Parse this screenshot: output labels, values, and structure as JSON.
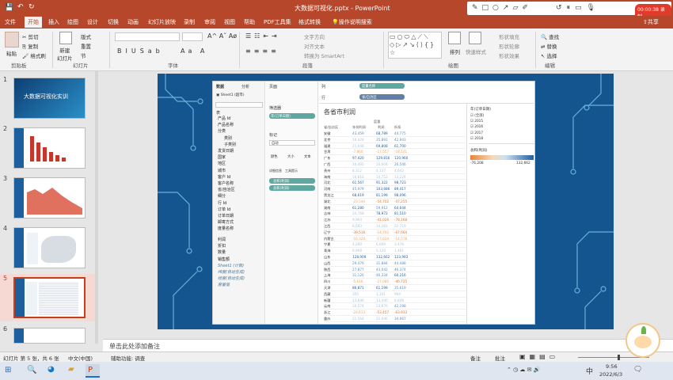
{
  "window": {
    "title": "大数据可视化.pptx - PowerPoint"
  },
  "ribbon_tabs": [
    "文件",
    "开始",
    "插入",
    "绘图",
    "设计",
    "切换",
    "动画",
    "幻灯片放映",
    "录制",
    "审阅",
    "视图",
    "帮助",
    "PDF工具集",
    "格式转换",
    "操作说明搜索"
  ],
  "share_label": "共享",
  "recording": {
    "time": "00:00:38 录制"
  },
  "ribbon": {
    "paste": "粘贴",
    "cut": "剪切",
    "copy": "复制",
    "format_painter": "格式刷",
    "new_slide": "新建\n幻灯片",
    "layout": "版式",
    "reset": "重置",
    "section": "节",
    "text_direction": "文字方向",
    "align_text": "对齐文本",
    "smartart": "转换为 SmartArt",
    "arrange": "排列",
    "quick_styles": "快速样式",
    "shape_fill": "形状填充",
    "shape_outline": "形状轮廓",
    "shape_effects": "形状效果",
    "find": "查找",
    "replace": "替换",
    "select": "选择",
    "groups": {
      "clipboard": "剪贴板",
      "slides": "幻灯片",
      "font": "字体",
      "paragraph": "段落",
      "drawing": "绘图",
      "editing": "编辑"
    }
  },
  "thumbnails": [
    {
      "num": "1",
      "title": "大数据可视化实训"
    },
    {
      "num": "2"
    },
    {
      "num": "3"
    },
    {
      "num": "4"
    },
    {
      "num": "5"
    },
    {
      "num": "6"
    }
  ],
  "tableau": {
    "tab_data": "数据",
    "tab_analysis": "分析",
    "source": "Sheet1 (超市)",
    "table_label": "表",
    "fields": [
      "产品 Id",
      "产品名称",
      "分类",
      "类别",
      "子类别",
      "发货日期",
      "国家",
      "地区",
      "城市",
      "客户 Id",
      "客户名称",
      "省/自治区",
      "细分",
      "行 Id",
      "订单 Id",
      "订单日期",
      "邮寄方式",
      "度量名称"
    ],
    "measures": [
      "利润",
      "折扣",
      "数量",
      "销售额",
      "Sheet1 (计数)",
      "纬度(自动生成)",
      "经度(自动生成)",
      "度量值"
    ],
    "pages": "页面",
    "filters": "筛选器",
    "filter_pill": "年(订单日期)",
    "marks": "标记",
    "mark_type": "自动",
    "mark_buttons": [
      "颜色",
      "大小",
      "文本",
      "详细信息",
      "工具提示"
    ],
    "mark_pills": [
      "总和(利润)",
      "总和(利润)"
    ],
    "columns": "列",
    "rows": "行",
    "col_pill": "度量名称",
    "row_pill": "省/自治区",
    "chart_title": "各省市利润",
    "col_header_group": "度量",
    "col_headers": [
      "省/自治区",
      "年份利润",
      "利润",
      "折扣"
    ],
    "rows_data": [
      [
        "安徽",
        "43,459",
        "68,789",
        "44,775"
      ],
      [
        "北京",
        "19,428",
        "35,891",
        "42,943"
      ],
      [
        "福建",
        "21,048",
        "69,808",
        "61,700"
      ],
      [
        "甘肃",
        "-7,860",
        "-17,557",
        "-18,141"
      ],
      [
        "广东",
        "97,420",
        "129,816",
        "120,960"
      ],
      [
        "广西",
        "16,491",
        "24,004",
        "26,546"
      ],
      [
        "贵州",
        "8,312",
        "4,137",
        "4,642"
      ],
      [
        "海南",
        "16,616",
        "14,752",
        "13,224"
      ],
      [
        "河北",
        "61,567",
        "91,322",
        "98,723"
      ],
      [
        "河南",
        "45,979",
        "103,686",
        "89,417"
      ],
      [
        "黑龙江",
        "68,619",
        "81,199",
        "98,096"
      ],
      [
        "湖北",
        "-23,540",
        "-54,702",
        "-47,255"
      ],
      [
        "湖南",
        "61,280",
        "59,912",
        "64,644"
      ],
      [
        "吉林",
        "24,768",
        "78,972",
        "81,510"
      ],
      [
        "江苏",
        "9,964",
        "-41,026",
        "-78,168"
      ],
      [
        "江西",
        "6,693",
        "14,281",
        "22,719"
      ],
      [
        "辽宁",
        "-39,516",
        "-14,792",
        "-67,664"
      ],
      [
        "内蒙古",
        "-10,324",
        "-17,624",
        "-14,578"
      ],
      [
        "宁夏",
        "4,290",
        "6,609",
        "3,476"
      ],
      [
        "青海",
        "6,908",
        "5,120",
        "1,461"
      ],
      [
        "山东",
        "128,909",
        "132,662",
        "123,993"
      ],
      [
        "山西",
        "29,476",
        "31,884",
        "44,488"
      ],
      [
        "陕西",
        "27,877",
        "43,042",
        "46,374"
      ],
      [
        "上海",
        "31,126",
        "46,334",
        "60,216"
      ],
      [
        "四川",
        "-5,616",
        "-27,085",
        "-46,725"
      ],
      [
        "天津",
        "86,871",
        "61,199",
        "35,619"
      ],
      [
        "西藏",
        "350",
        "1,101",
        "994"
      ],
      [
        "新疆",
        "13,846",
        "13,440",
        "8,848"
      ],
      [
        "云南",
        "20,574",
        "23,670",
        "42,198"
      ],
      [
        "浙江",
        "-24,613",
        "-53,457",
        "-63,933"
      ],
      [
        "重庆",
        "21,564",
        "22,046",
        "34,067"
      ]
    ],
    "legend_title": "年(订单日期)",
    "legend_items": [
      "(全部)",
      "2015",
      "2016",
      "2017",
      "2018"
    ],
    "color_legend_title": "总和(利润)",
    "color_min": "-76,208",
    "color_max": "132,662"
  },
  "notes_placeholder": "单击此处添加备注",
  "status": {
    "slide": "幻灯片 第 5 张，共 6 张",
    "lang": "中文(中国)",
    "accessibility": "辅助功能: 调查",
    "notes": "备注",
    "comments": "批注"
  },
  "taskbar": {
    "time": "9:56",
    "date": "2022/6/3",
    "ime": "中"
  }
}
